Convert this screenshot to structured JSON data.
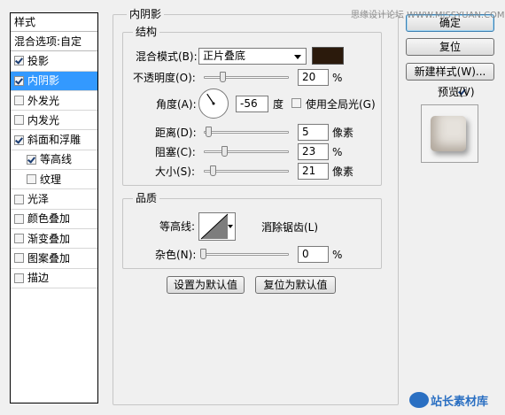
{
  "styles_panel": {
    "header": "样式",
    "blend_label": "混合选项:自定",
    "items": [
      {
        "label": "投影",
        "checked": true,
        "selected": false,
        "indent": false
      },
      {
        "label": "内阴影",
        "checked": true,
        "selected": true,
        "indent": false
      },
      {
        "label": "外发光",
        "checked": false,
        "selected": false,
        "indent": false
      },
      {
        "label": "内发光",
        "checked": false,
        "selected": false,
        "indent": false
      },
      {
        "label": "斜面和浮雕",
        "checked": true,
        "selected": false,
        "indent": false
      },
      {
        "label": "等高线",
        "checked": true,
        "selected": false,
        "indent": true
      },
      {
        "label": "纹理",
        "checked": false,
        "selected": false,
        "indent": true
      },
      {
        "label": "光泽",
        "checked": false,
        "selected": false,
        "indent": false
      },
      {
        "label": "颜色叠加",
        "checked": false,
        "selected": false,
        "indent": false
      },
      {
        "label": "渐变叠加",
        "checked": false,
        "selected": false,
        "indent": false
      },
      {
        "label": "图案叠加",
        "checked": false,
        "selected": false,
        "indent": false
      },
      {
        "label": "描边",
        "checked": false,
        "selected": false,
        "indent": false
      }
    ]
  },
  "inner_shadow": {
    "title": "内阴影",
    "structure": {
      "title": "结构",
      "blend_mode_label": "混合模式(B):",
      "blend_mode_value": "正片叠底",
      "shadow_color": "#2b1a0c",
      "opacity_label": "不透明度(O):",
      "opacity_value": "20",
      "opacity_unit": "%",
      "opacity_fraction": 0.2,
      "angle_label": "角度(A):",
      "angle_value": "-56",
      "angle_unit": "度",
      "global_light_label": "使用全局光(G)",
      "global_light_checked": false,
      "distance_label": "距离(D):",
      "distance_value": "5",
      "distance_unit": "像素",
      "distance_fraction": 0.02,
      "choke_label": "阻塞(C):",
      "choke_value": "23",
      "choke_unit": "%",
      "choke_fraction": 0.23,
      "size_label": "大小(S):",
      "size_value": "21",
      "size_unit": "像素",
      "size_fraction": 0.08
    },
    "quality": {
      "title": "品质",
      "contour_label": "等高线:",
      "antialias_label": "消除锯齿(L)",
      "antialias_checked": false,
      "noise_label": "杂色(N):",
      "noise_value": "0",
      "noise_unit": "%",
      "noise_fraction": 0.0
    },
    "make_default": "设置为默认值",
    "reset_default": "复位为默认值"
  },
  "buttons": {
    "ok": "确定",
    "reset": "复位",
    "new_style": "新建样式(W)...",
    "preview_label": "预览(V)",
    "preview_checked": true
  },
  "watermark_top": "思缘设计论坛  WWW.MISSYUAN.COM",
  "watermark_bottom": "站长素材库"
}
